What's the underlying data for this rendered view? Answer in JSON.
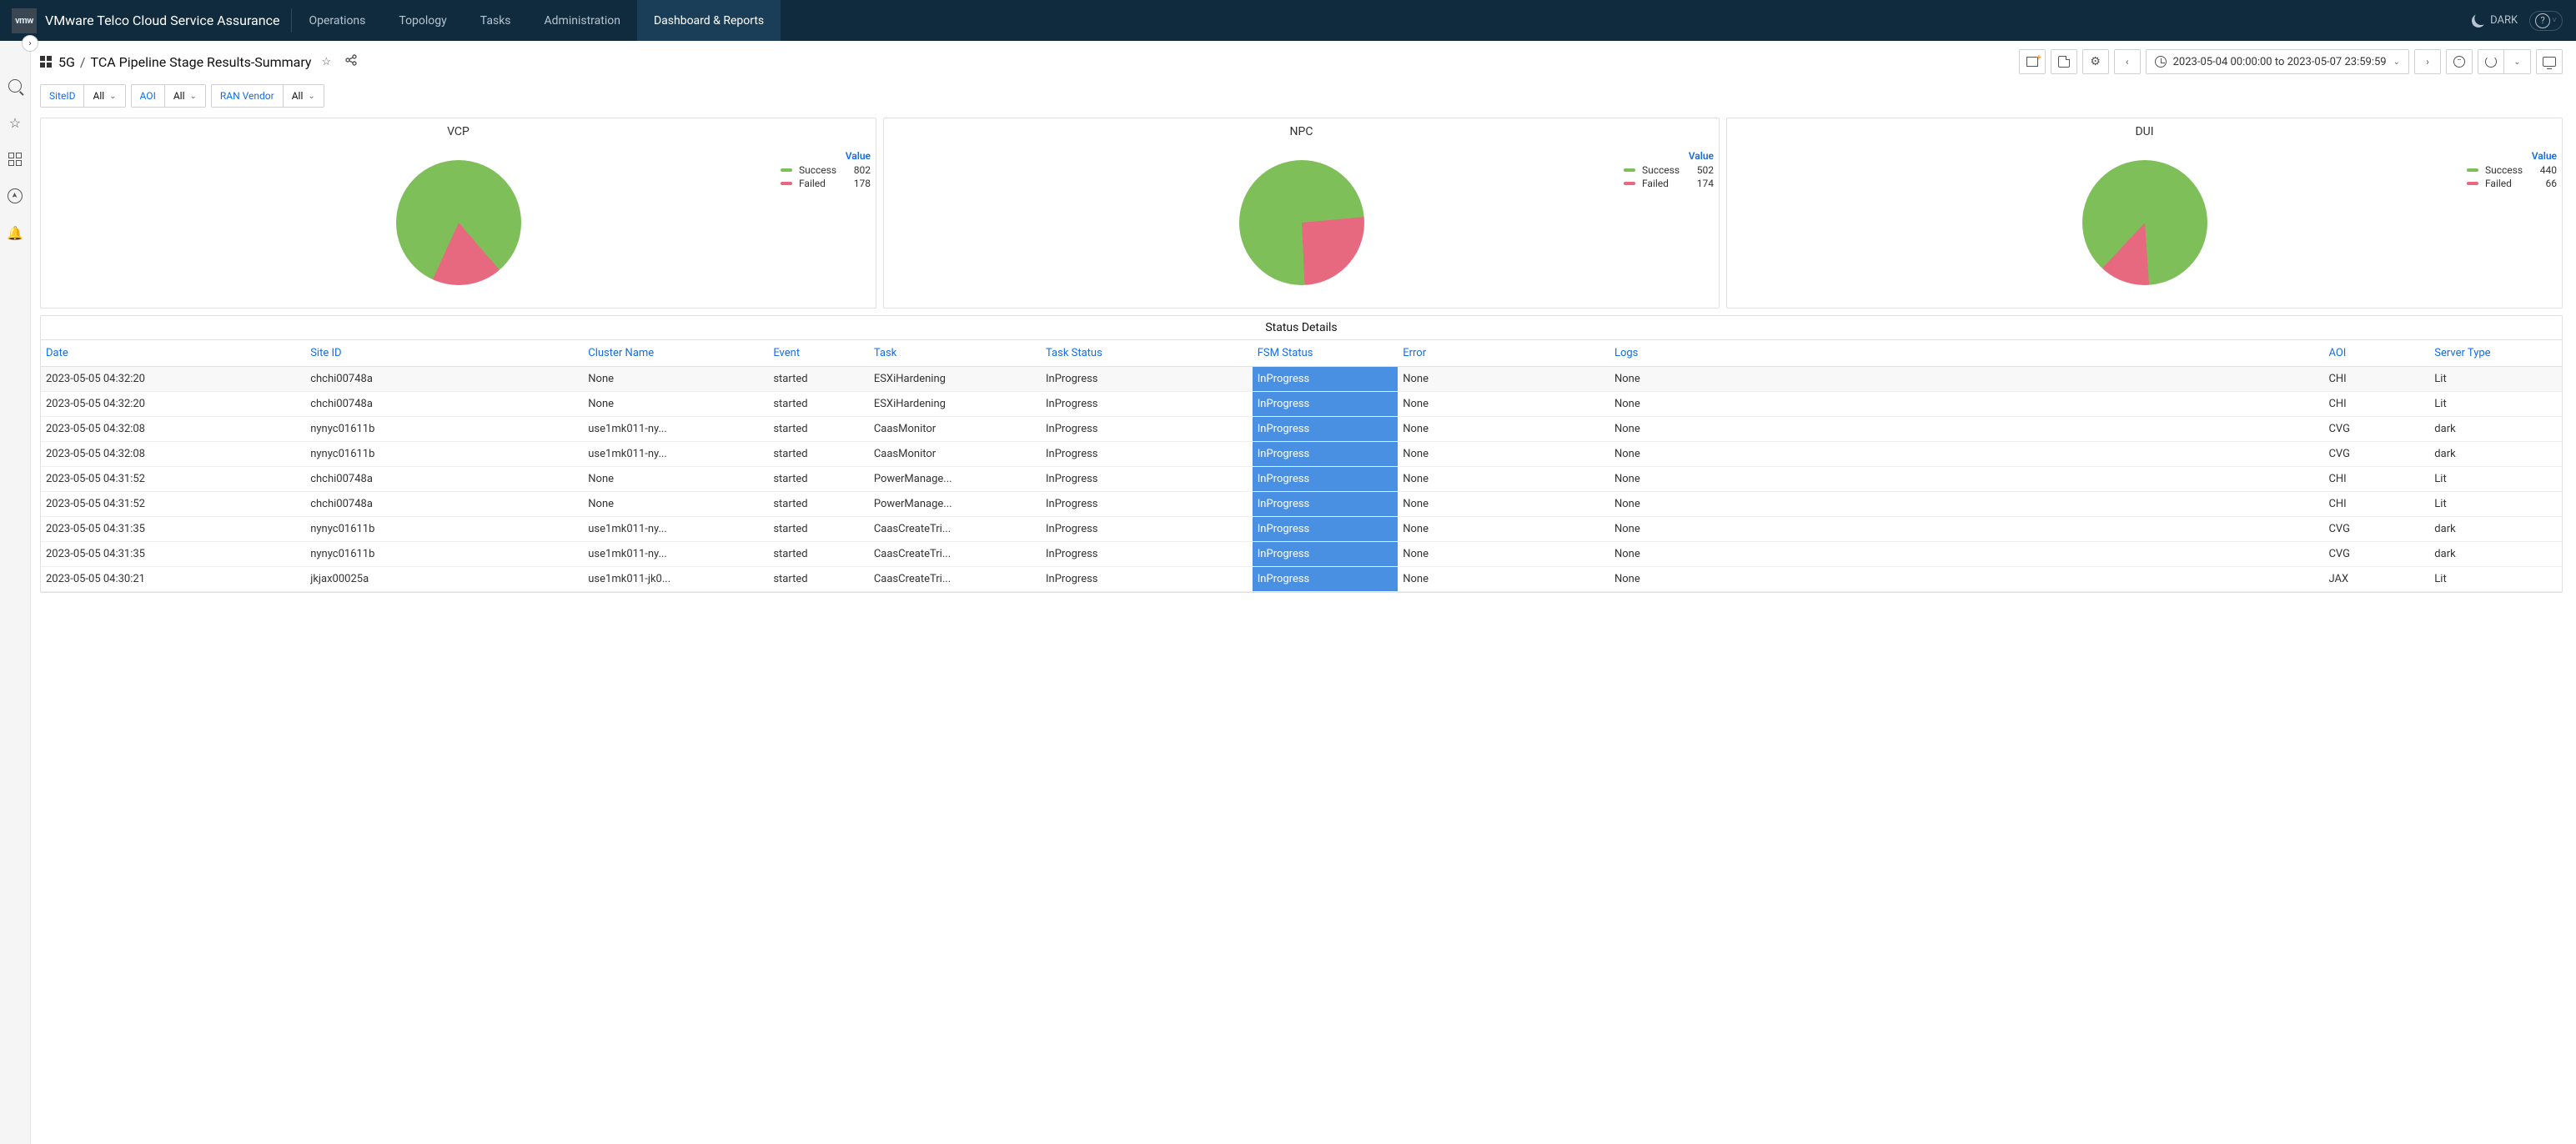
{
  "brand": {
    "logo_text": "vmw",
    "name": "VMware Telco Cloud Service Assurance"
  },
  "nav": {
    "tabs": [
      "Operations",
      "Topology",
      "Tasks",
      "Administration",
      "Dashboard & Reports"
    ],
    "active_index": 4,
    "theme": "DARK"
  },
  "breadcrumb": {
    "root": "5G",
    "leaf": "TCA Pipeline Stage Results-Summary"
  },
  "time_range": "2023-05-04 00:00:00 to 2023-05-07 23:59:59",
  "variables": [
    {
      "label": "SiteID",
      "value": "All"
    },
    {
      "label": "AOI",
      "value": "All"
    },
    {
      "label": "RAN Vendor",
      "value": "All"
    }
  ],
  "chart_data": [
    {
      "type": "pie",
      "title": "VCP",
      "value_header": "Value",
      "series": [
        {
          "name": "Success",
          "value": 802,
          "color": "#7fbf5a"
        },
        {
          "name": "Failed",
          "value": 178,
          "color": "#e7697f"
        }
      ]
    },
    {
      "type": "pie",
      "title": "NPC",
      "value_header": "Value",
      "series": [
        {
          "name": "Success",
          "value": 502,
          "color": "#7fbf5a"
        },
        {
          "name": "Failed",
          "value": 174,
          "color": "#e7697f"
        }
      ]
    },
    {
      "type": "pie",
      "title": "DUI",
      "value_header": "Value",
      "series": [
        {
          "name": "Success",
          "value": 440,
          "color": "#7fbf5a"
        },
        {
          "name": "Failed",
          "value": 66,
          "color": "#e7697f"
        }
      ]
    }
  ],
  "table": {
    "title": "Status Details",
    "columns": [
      "Date",
      "Site ID",
      "Cluster Name",
      "Event",
      "Task",
      "Task Status",
      "FSM Status",
      "Error",
      "Logs",
      "AOI",
      "Server Type"
    ],
    "rows": [
      [
        "2023-05-05 04:32:20",
        "chchi00748a",
        "None",
        "started",
        "ESXiHardening",
        "InProgress",
        "InProgress",
        "None",
        "None",
        "CHI",
        "Lit"
      ],
      [
        "2023-05-05 04:32:20",
        "chchi00748a",
        "None",
        "started",
        "ESXiHardening",
        "InProgress",
        "InProgress",
        "None",
        "None",
        "CHI",
        "Lit"
      ],
      [
        "2023-05-05 04:32:08",
        "nynyc01611b",
        "use1mk011-ny...",
        "started",
        "CaasMonitor",
        "InProgress",
        "InProgress",
        "None",
        "None",
        "CVG",
        "dark"
      ],
      [
        "2023-05-05 04:32:08",
        "nynyc01611b",
        "use1mk011-ny...",
        "started",
        "CaasMonitor",
        "InProgress",
        "InProgress",
        "None",
        "None",
        "CVG",
        "dark"
      ],
      [
        "2023-05-05 04:31:52",
        "chchi00748a",
        "None",
        "started",
        "PowerManage...",
        "InProgress",
        "InProgress",
        "None",
        "None",
        "CHI",
        "Lit"
      ],
      [
        "2023-05-05 04:31:52",
        "chchi00748a",
        "None",
        "started",
        "PowerManage...",
        "InProgress",
        "InProgress",
        "None",
        "None",
        "CHI",
        "Lit"
      ],
      [
        "2023-05-05 04:31:35",
        "nynyc01611b",
        "use1mk011-ny...",
        "started",
        "CaasCreateTri...",
        "InProgress",
        "InProgress",
        "None",
        "None",
        "CVG",
        "dark"
      ],
      [
        "2023-05-05 04:31:35",
        "nynyc01611b",
        "use1mk011-ny...",
        "started",
        "CaasCreateTri...",
        "InProgress",
        "InProgress",
        "None",
        "None",
        "CVG",
        "dark"
      ],
      [
        "2023-05-05 04:30:21",
        "jkjax00025a",
        "use1mk011-jk0...",
        "started",
        "CaasCreateTri...",
        "InProgress",
        "InProgress",
        "None",
        "None",
        "JAX",
        "Lit"
      ]
    ]
  }
}
